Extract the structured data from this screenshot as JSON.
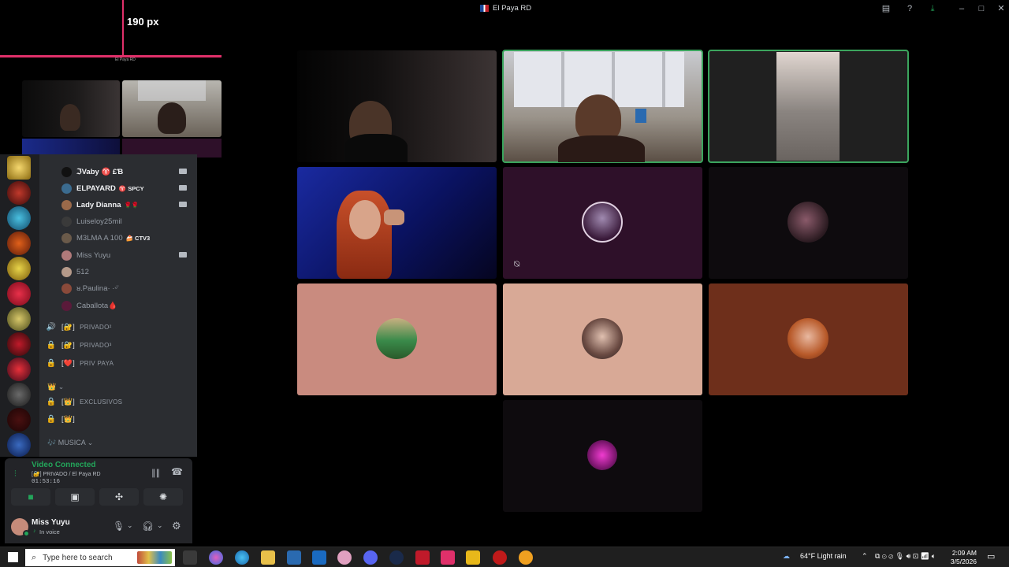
{
  "window": {
    "title": "El Paya RD"
  },
  "overlay": {
    "measure_label": "190 px",
    "tiny_label": "El Paya RD"
  },
  "members": [
    {
      "name": "ℑVaby ♈ £Ɓ",
      "tag": "",
      "bold": true,
      "camera": true,
      "color": "#111"
    },
    {
      "name": "ELPAYARD",
      "tag": "♈ SPCY",
      "bold": true,
      "camera": true,
      "color": "#3b6b8f"
    },
    {
      "name": "Lady Dianna",
      "tag": "🌹🌹",
      "bold": true,
      "camera": true,
      "color": "#9b6a4a"
    },
    {
      "name": "Luiseloy25mil",
      "tag": "",
      "bold": false,
      "camera": false,
      "color": "#3a3a3a"
    },
    {
      "name": "M3LMA A 100",
      "tag": "🍰 CTV3",
      "bold": false,
      "camera": false,
      "color": "#6a5a4a"
    },
    {
      "name": "Miss Yuyu",
      "tag": "",
      "bold": false,
      "camera": true,
      "color": "#b07a7a"
    },
    {
      "name": "512",
      "tag": "",
      "bold": false,
      "camera": false,
      "color": "#b59a8a"
    },
    {
      "name": "ᴚ.Paulina· ·ᵕ̈",
      "tag": "",
      "bold": false,
      "camera": false,
      "color": "#8a4a3a"
    },
    {
      "name": "Caballota🩸",
      "tag": "",
      "bold": false,
      "camera": false,
      "color": "#5a1a3a"
    }
  ],
  "channels": [
    {
      "icon": "🔊",
      "bracket": "[🔐]",
      "name": "PRIVADO²"
    },
    {
      "icon": "🔒",
      "bracket": "[🔐]",
      "name": "PRIVADO³"
    },
    {
      "icon": "🔒",
      "bracket": "[❤️]",
      "name": "PRIV PAYA"
    }
  ],
  "category_crown": "👑 ⌄",
  "channels2": [
    {
      "icon": "🔒",
      "bracket": "[👑]",
      "name": "EXCLUSIVOS"
    },
    {
      "icon": "🔒",
      "bracket": "[👑]",
      "name": ""
    }
  ],
  "category_music": "🎶 MUSICA ⌄",
  "voice": {
    "status": "Video Connected",
    "channel": "[🔐] PRIVADO / El Paya RD",
    "timer": "01:53:16"
  },
  "user": {
    "name": "Miss Yuyu",
    "status": "In voice"
  },
  "taskbar": {
    "search_placeholder": "Type here to search",
    "weather": "64°F  Light rain",
    "time": "2:09 AM",
    "date": "3/5/2026"
  },
  "colors": {
    "speaking": "#3ba55d",
    "tile_purple": "#2e1029",
    "tile_salmon": "#c98b7f",
    "tile_peach": "#d8a996",
    "tile_brown": "#6e2f1b",
    "tile_dark": "#0e0b0e"
  }
}
